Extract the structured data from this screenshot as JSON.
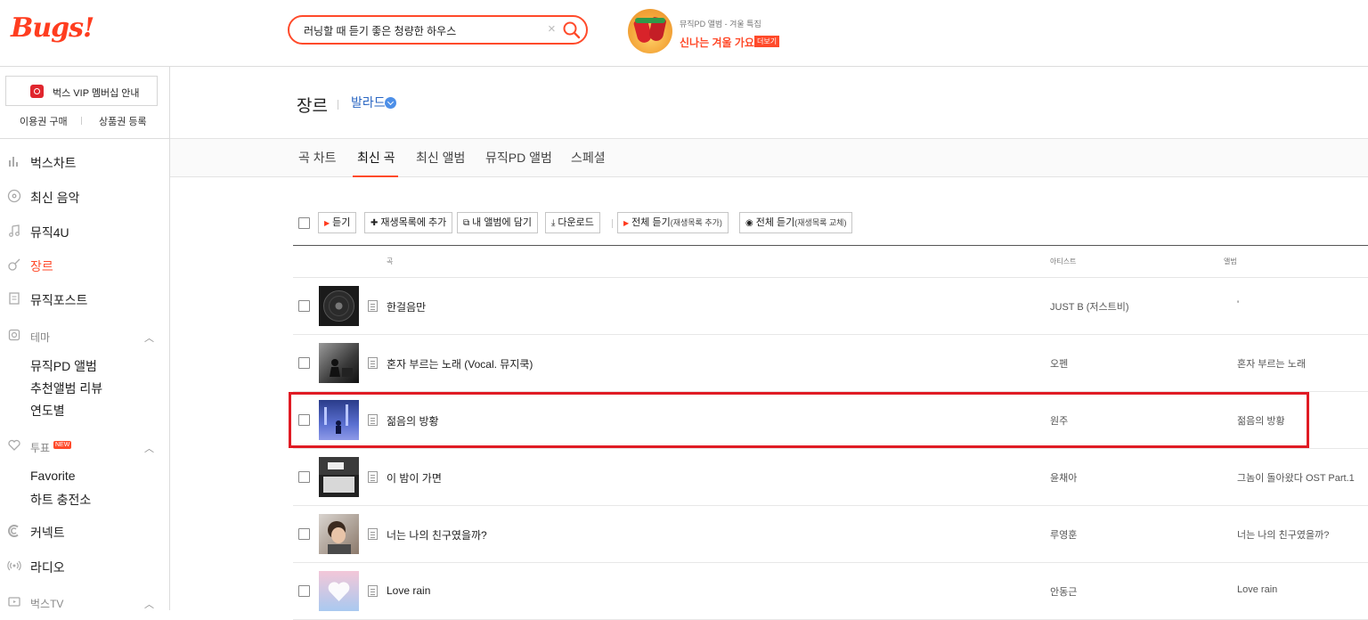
{
  "header": {
    "logo": "Bugs!",
    "search": {
      "value": "러닝할 때 듣기 좋은 청량한 하우스",
      "clear": "×"
    },
    "promo": {
      "subtitle": "뮤직PD 앨범 - 겨울 특집",
      "title": "신나는 겨울 가요",
      "more": "더보기"
    }
  },
  "sidebar": {
    "vip_button": "벅스 VIP 멤버십 안내",
    "links": [
      "이용권 구매",
      "상품권 등록"
    ],
    "nav": [
      {
        "label": "벅스차트",
        "icon": "chart-icon"
      },
      {
        "label": "최신 음악",
        "icon": "disc-icon"
      },
      {
        "label": "뮤직4U",
        "icon": "music-note-icon"
      },
      {
        "label": "장르",
        "icon": "guitar-icon",
        "active": true
      },
      {
        "label": "뮤직포스트",
        "icon": "post-icon"
      },
      {
        "label": "테마",
        "icon": "theme-icon"
      },
      {
        "label": "투표",
        "icon": "heart-icon",
        "badge": "NEW"
      },
      {
        "label": "커넥트",
        "icon": "connect-icon"
      },
      {
        "label": "라디오",
        "icon": "radio-icon"
      },
      {
        "label": "벅스TV",
        "icon": "tv-icon"
      }
    ],
    "theme_sub": [
      "뮤직PD 앨범",
      "추천앨범 리뷰",
      "연도별"
    ],
    "vote_sub": [
      "Favorite",
      "하트 충전소"
    ]
  },
  "main": {
    "title": "장르",
    "genre": "발라드",
    "tabs": [
      "곡 차트",
      "최신 곡",
      "최신 앨범",
      "뮤직PD 앨범",
      "스페셜"
    ],
    "active_tab": "최신 곡",
    "toolbar": {
      "play": "듣기",
      "add_playlist": "재생목록에 추가",
      "add_album": "내 앨범에 담기",
      "download": "다운로드",
      "play_all_add": "전체 듣기",
      "play_all_add_note": "(재생목록 추가)",
      "play_all_replace": "전체 듣기",
      "play_all_replace_note": "(재생목록 교체)"
    },
    "columns": {
      "song": "곡",
      "artist": "아티스트",
      "album": "앨범"
    },
    "songs": [
      {
        "title": "한걸음만",
        "artist": "JUST B (저스트비)",
        "album": "'"
      },
      {
        "title": "혼자 부르는 노래 (Vocal. 뮤지쿡)",
        "artist": "오펜",
        "album": "혼자 부르는 노래"
      },
      {
        "title": "젊음의 방황",
        "artist": "원주",
        "album": "젊음의 방황"
      },
      {
        "title": "이 밤이 가면",
        "artist": "윤채아",
        "album": "그놈이 돌아왔다 OST Part.1"
      },
      {
        "title": "너는 나의 친구였을까?",
        "artist": "루영훈",
        "album": "너는 나의 친구였을까?"
      },
      {
        "title": "Love rain",
        "artist": "안동근",
        "album": "Love rain"
      }
    ]
  },
  "colors": {
    "accent": "#ff4a2a",
    "highlight": "#e01b24",
    "link": "#2a66c2"
  }
}
